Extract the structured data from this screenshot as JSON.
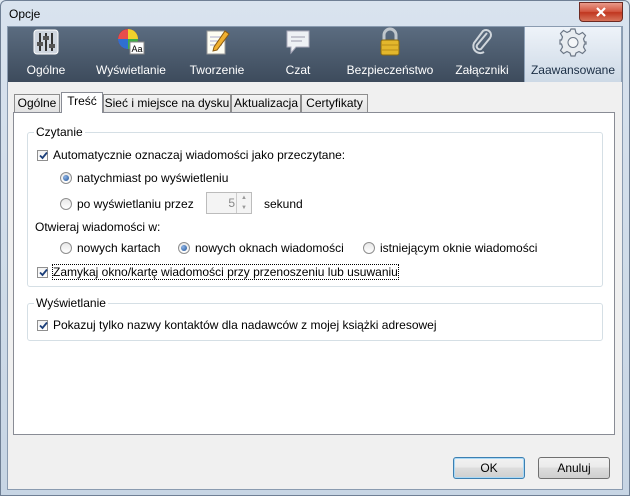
{
  "window": {
    "title": "Opcje"
  },
  "toolbar": {
    "items": [
      {
        "label": "Ogólne",
        "icon": "switches-icon"
      },
      {
        "label": "Wyświetlanie",
        "icon": "color-wheel-icon"
      },
      {
        "label": "Tworzenie",
        "icon": "notepad-pencil-icon"
      },
      {
        "label": "Czat",
        "icon": "speech-bubble-icon"
      },
      {
        "label": "Bezpieczeństwo",
        "icon": "padlock-icon"
      },
      {
        "label": "Załączniki",
        "icon": "paperclip-icon"
      },
      {
        "label": "Zaawansowane",
        "icon": "gear-icon"
      }
    ],
    "selected": "Zaawansowane"
  },
  "tabs": {
    "items": [
      "Ogólne",
      "Treść",
      "Sieć i miejsce na dysku",
      "Aktualizacja",
      "Certyfikaty"
    ],
    "active": "Treść"
  },
  "reading": {
    "legend": "Czytanie",
    "auto_mark": {
      "label": "Automatycznie oznaczaj wiadomości jako przeczytane:",
      "checked": true
    },
    "immediately": {
      "label": "natychmiast po wyświetleniu",
      "checked": true
    },
    "after_delay": {
      "label": "po wyświetlaniu przez",
      "checked": false
    },
    "delay_value": "5",
    "delay_unit": "sekund",
    "open_in_label": "Otwieraj wiadomości w:",
    "open_options": [
      {
        "label": "nowych kartach",
        "checked": false
      },
      {
        "label": "nowych oknach wiadomości",
        "checked": true
      },
      {
        "label": "istniejącym oknie wiadomości",
        "checked": false
      }
    ],
    "close_on_move": {
      "label": "Zamykaj okno/kartę wiadomości przy przenoszeniu lub usuwaniu",
      "checked": true
    }
  },
  "display": {
    "legend": "Wyświetlanie",
    "show_names": {
      "label": "Pokazuj tylko nazwy kontaktów dla nadawców z mojej książki adresowej",
      "checked": true
    }
  },
  "buttons": {
    "ok": "OK",
    "cancel": "Anuluj"
  }
}
